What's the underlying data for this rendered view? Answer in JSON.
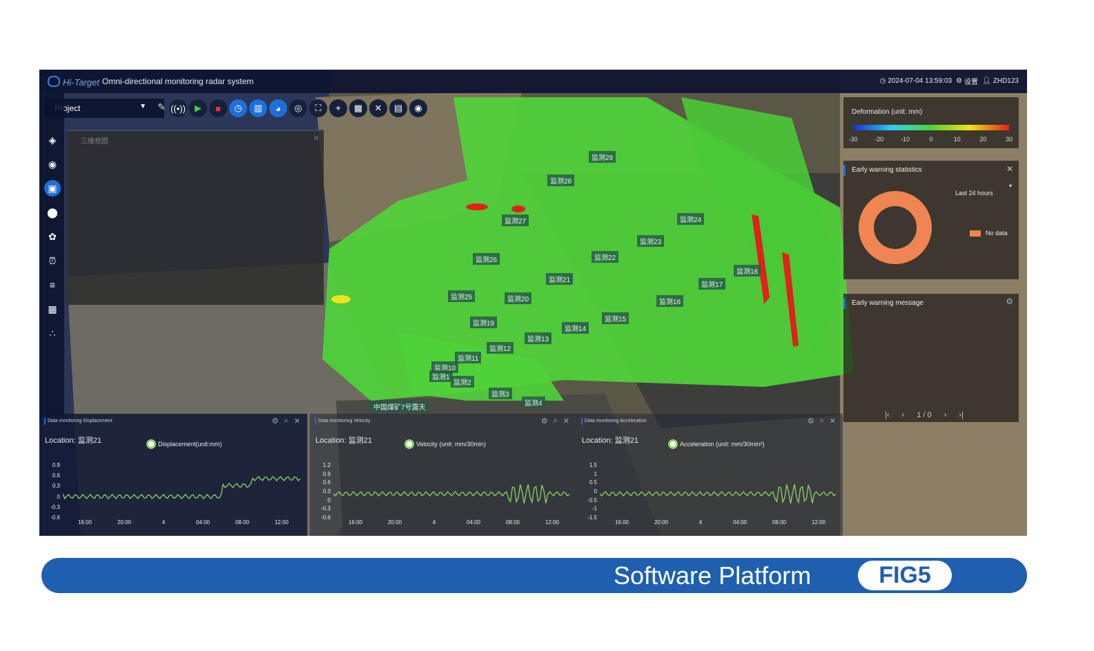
{
  "app": {
    "logo": "Hi-Target",
    "title": "Omni-directional monitoring radar system",
    "datetime": "2024-07-04 13:59:03",
    "settings_label": "设置",
    "user": "ZHD123"
  },
  "toolbar": {
    "project_label": "Project"
  },
  "layer_panel": {
    "title": "三维视图"
  },
  "map_labels": [
    "监测29",
    "监测28",
    "监测27",
    "监测24",
    "监测23",
    "监测26",
    "监测22",
    "监测21",
    "监测18",
    "监测17",
    "监测25",
    "监测20",
    "监测16",
    "监测15",
    "监测19",
    "监测14",
    "监测13",
    "监测12",
    "监测11",
    "监测10",
    "监测1",
    "监测2",
    "监测3",
    "监测4",
    "中国煤矿7号露天"
  ],
  "deformation": {
    "title": "Deformation (unit: mm)",
    "ticks": [
      "-30",
      "-20",
      "-10",
      "0",
      "10",
      "20",
      "30"
    ]
  },
  "stats": {
    "title": "Early warning statistics",
    "period": "Last 24 hours",
    "legend": "No data",
    "donut_color": "#f08452"
  },
  "messages": {
    "title": "Early warning message",
    "page": "1 / 0"
  },
  "panels": [
    {
      "title": "Data monitoring Displacement",
      "location": "Location: 监测21",
      "legend": "Displacement(unit:mm)",
      "y_ticks": [
        "0.9",
        "0.6",
        "0.3",
        "0",
        "-0.3",
        "-0.6"
      ],
      "x_ticks": [
        "16:00",
        "20:00",
        "4",
        "04:00",
        "08:00",
        "12:00"
      ]
    },
    {
      "title": "Data monitoring Velocity",
      "location": "Location: 监测21",
      "legend": "Velocity (unit: mm/30min)",
      "y_ticks": [
        "1.2",
        "0.9",
        "0.6",
        "0.3",
        "0",
        "-0.3",
        "-0.6"
      ],
      "x_ticks": [
        "16:00",
        "20:00",
        "4",
        "04:00",
        "08:00",
        "12:00"
      ]
    },
    {
      "title": "Data monitoring Acceleration",
      "location": "Location: 监测21",
      "legend": "Acceleration (unit: mm/30min²)",
      "y_ticks": [
        "1.5",
        "1",
        "0.5",
        "0",
        "-0.5",
        "-1",
        "-1.5"
      ],
      "x_ticks": [
        "16:00",
        "20:00",
        "4",
        "04:00",
        "08:00",
        "12:00"
      ]
    }
  ],
  "banner": {
    "title": "Software Platform",
    "badge": "FIG5"
  },
  "colors": {
    "accent": "#1e6fd9",
    "banner": "#1f5fb0",
    "series": "#8fd36a",
    "deformation_green": "#4fd33a",
    "deformation_red": "#e0221a"
  }
}
